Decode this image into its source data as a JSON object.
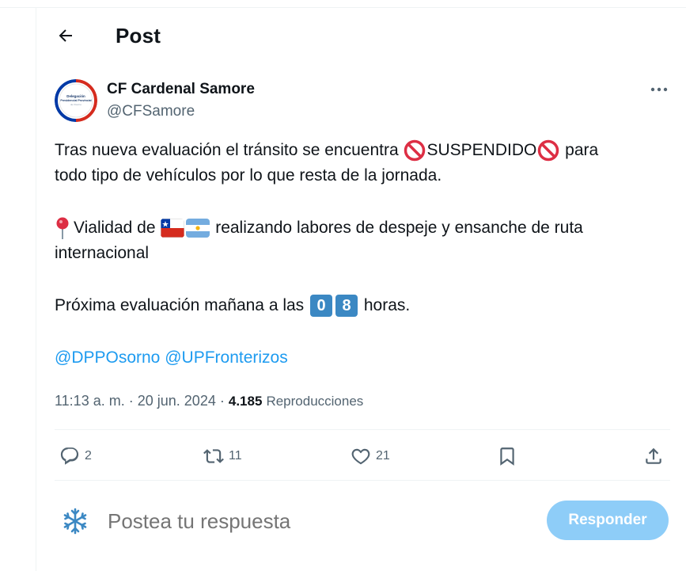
{
  "header": {
    "title": "Post"
  },
  "author": {
    "name": "CF Cardenal Samore",
    "handle": "@CFSamore",
    "avatar_text_line1": "Delegación",
    "avatar_text_line2": "Presidencial Provincial",
    "avatar_text_line3": "de Osorno"
  },
  "tweet": {
    "line1_a": "Tras nueva evaluación el tránsito se encuentra ",
    "line1_b": "SUSPENDIDO",
    "line1_c": " para",
    "line2": "todo tipo de vehículos por lo que resta de la jornada.",
    "line3_a": "Vialidad de ",
    "line3_b": " realizando labores de despeje y ensanche de ruta",
    "line4": "internacional",
    "line5_a": "Próxima evaluación mañana a las ",
    "keycap1": "0",
    "keycap2": "8",
    "line5_b": " horas.",
    "mention1": "@DPPOsorno",
    "mention2": "@UPFronterizos"
  },
  "meta": {
    "time": "11:13 a. m.",
    "separator": "·",
    "date": "20 jun. 2024",
    "views_count": "4.185",
    "views_label": "Reproducciones"
  },
  "actions": {
    "replies": "2",
    "reposts": "11",
    "likes": "21"
  },
  "reply_box": {
    "placeholder": "Postea tu respuesta",
    "button_label": "Responder"
  },
  "colors": {
    "accent": "#1d9bf0",
    "reply_button_disabled": "#8ecdf8",
    "secondary_text": "#536471",
    "keycap": "#3b88c3"
  }
}
